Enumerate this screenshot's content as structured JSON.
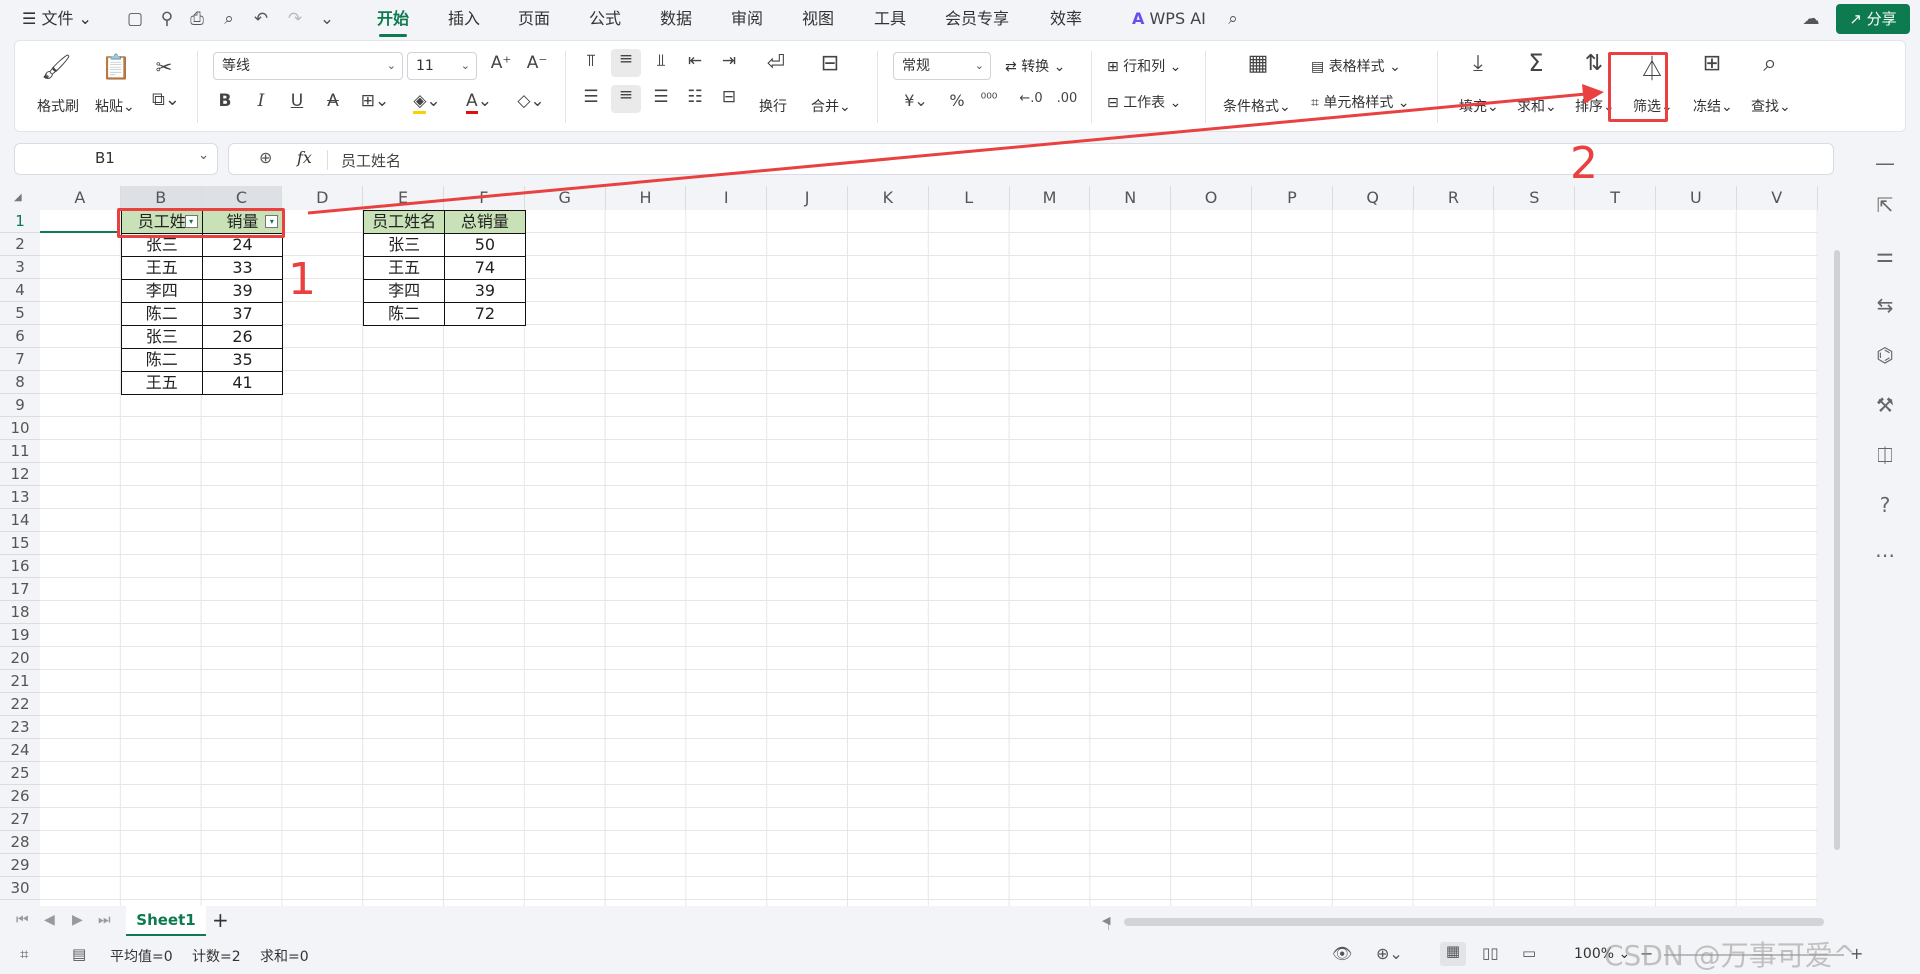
{
  "menu": {
    "file": "文件",
    "tabs": [
      "开始",
      "插入",
      "页面",
      "公式",
      "数据",
      "审阅",
      "视图",
      "工具",
      "会员专享",
      "效率"
    ],
    "wps_ai": "WPS AI",
    "share": "分享"
  },
  "ribbon": {
    "format_painter": "格式刷",
    "paste": "粘贴",
    "font_name": "等线",
    "font_size": "11",
    "bold": "B",
    "italic": "I",
    "underline": "U",
    "wrap": "换行",
    "merge": "合并",
    "number_format": "常规",
    "convert": "转换",
    "rows_cols": "行和列",
    "worksheet": "工作表",
    "cond_format": "条件格式",
    "table_style": "表格样式",
    "cell_style": "单元格样式",
    "fill": "填充",
    "sum": "求和",
    "sort": "排序",
    "filter": "筛选",
    "freeze": "冻结",
    "find": "查找",
    "currency": "¥",
    "percent": "%"
  },
  "formula": {
    "name_box": "B1",
    "fx": "fx",
    "content": "员工姓名"
  },
  "columns": [
    "A",
    "B",
    "C",
    "D",
    "E",
    "F",
    "G",
    "H",
    "I",
    "J",
    "K",
    "L",
    "M",
    "N",
    "O",
    "P",
    "Q",
    "R",
    "S",
    "T",
    "U",
    "V"
  ],
  "rows": [
    "1",
    "2",
    "3",
    "4",
    "5",
    "6",
    "7",
    "8",
    "9",
    "10",
    "11",
    "12",
    "13",
    "14",
    "15",
    "16",
    "17",
    "18",
    "19",
    "20",
    "21",
    "22",
    "23",
    "24",
    "25",
    "26",
    "27",
    "28",
    "29",
    "30"
  ],
  "table1": {
    "headers": [
      "员工姓",
      "销量"
    ],
    "rows": [
      [
        "张三",
        "24"
      ],
      [
        "王五",
        "33"
      ],
      [
        "李四",
        "39"
      ],
      [
        "陈二",
        "37"
      ],
      [
        "张三",
        "26"
      ],
      [
        "陈二",
        "35"
      ],
      [
        "王五",
        "41"
      ]
    ]
  },
  "table2": {
    "headers": [
      "员工姓名",
      "总销量"
    ],
    "rows": [
      [
        "张三",
        "50"
      ],
      [
        "王五",
        "74"
      ],
      [
        "李四",
        "39"
      ],
      [
        "陈二",
        "72"
      ]
    ]
  },
  "annotations": {
    "step1": "1",
    "step2": "2",
    "color": "#e8413f"
  },
  "sheet": {
    "tab": "Sheet1",
    "add": "+"
  },
  "status": {
    "avg": "平均值=0",
    "count": "计数=2",
    "sum": "求和=0",
    "zoom": "100%",
    "watermark": "CSDN @万事可爱^"
  },
  "colors": {
    "accent": "#0d7a4f",
    "header_fill": "#c9e1b7"
  }
}
